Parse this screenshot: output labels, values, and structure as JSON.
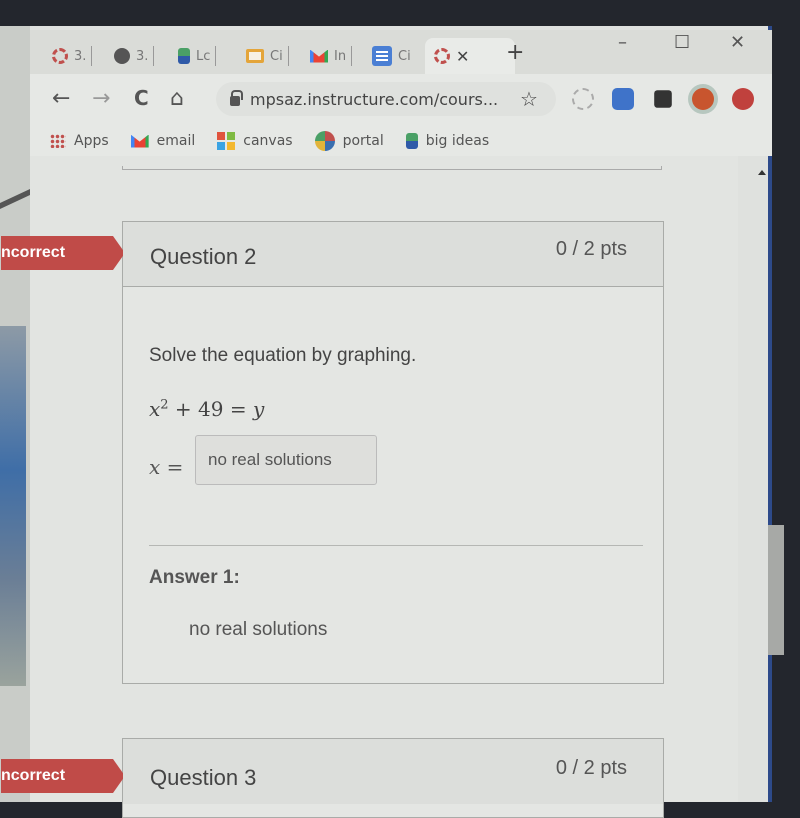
{
  "browser": {
    "tabs": [
      {
        "label": "3.",
        "icon": "canvas-icon"
      },
      {
        "label": "3.",
        "icon": "globe-icon"
      },
      {
        "label": "Lc",
        "icon": "big-ideas-icon"
      },
      {
        "label": "Ci",
        "icon": "slides-icon"
      },
      {
        "label": "In",
        "icon": "gmail-icon"
      },
      {
        "label": "Ci",
        "icon": "docs-icon"
      },
      {
        "label": "",
        "icon": "canvas-icon",
        "active": true
      }
    ],
    "new_tab": "+",
    "window_controls": {
      "minimize": "–",
      "maximize": "☐",
      "close": "✕"
    },
    "nav": {
      "back": "←",
      "forward": "→",
      "reload": "C",
      "home": "⌂"
    },
    "url": "mpsaz.instructure.com/cours...",
    "bookmark_star": "☆",
    "bookmarks": [
      {
        "label": "Apps",
        "icon": "apps-grid-icon"
      },
      {
        "label": "email",
        "icon": "gmail-icon"
      },
      {
        "label": "canvas",
        "icon": "microsoft-grid-icon"
      },
      {
        "label": "portal",
        "icon": "portal-icon"
      },
      {
        "label": "big ideas",
        "icon": "big-ideas-icon"
      }
    ]
  },
  "questions": [
    {
      "status": "ncorrect",
      "title": "Question 2",
      "points": "0 / 2 pts",
      "prompt": "Solve the equation by graphing.",
      "equation": {
        "lhs_var": "x",
        "exponent": "2",
        "rest": " + 49 = ",
        "rhs_var": "y"
      },
      "input_label_var": "x",
      "input_label_eq": " =",
      "input_value": "no real solutions",
      "answer_label": "Answer 1:",
      "answer_value": "no real solutions"
    },
    {
      "status": "ncorrect",
      "title": "Question 3",
      "points": "0 / 2 pts"
    }
  ],
  "colors": {
    "incorrect_badge": "#c04b48",
    "window_border": "#2d4a8a"
  }
}
